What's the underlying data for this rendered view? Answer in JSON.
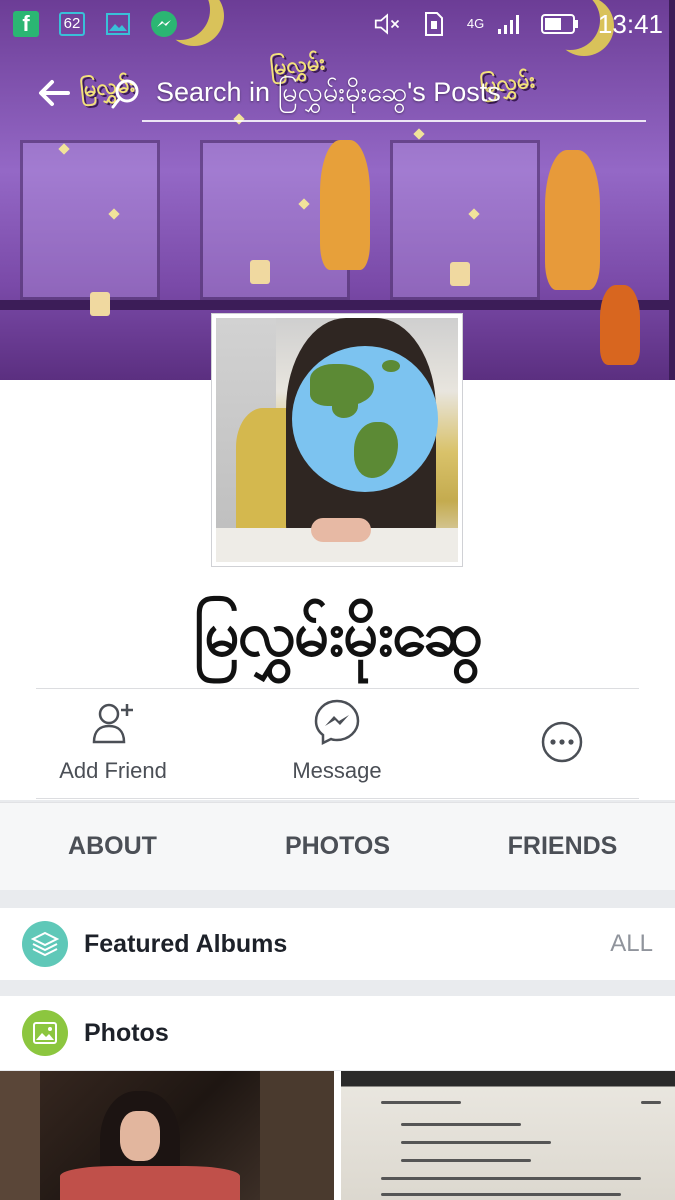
{
  "status_bar": {
    "badge_count": "62",
    "network": "4G",
    "time": "13:41"
  },
  "search": {
    "placeholder": "Search in မြလွှမ်းမိုးဆွေ's Posts"
  },
  "profile": {
    "name": "မြလွှမ်းမိုးဆွေ"
  },
  "actions": [
    {
      "label": "Add Friend"
    },
    {
      "label": "Message"
    },
    {
      "label": ""
    }
  ],
  "tabs": [
    {
      "label": "ABOUT"
    },
    {
      "label": "PHOTOS"
    },
    {
      "label": "FRIENDS"
    }
  ],
  "sections": {
    "featured_albums": {
      "title": "Featured Albums",
      "action": "ALL"
    },
    "photos": {
      "title": "Photos"
    }
  },
  "colors": {
    "albums_icon_bg": "#5fc8b8",
    "photos_icon_bg": "#8cc63f",
    "text_gray": "#4b4f56"
  }
}
